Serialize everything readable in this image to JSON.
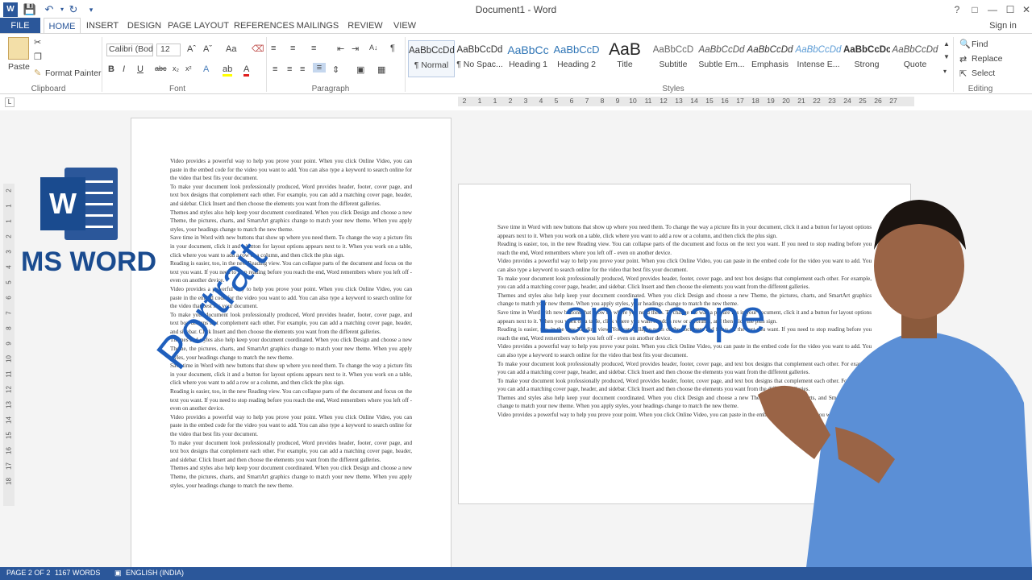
{
  "window": {
    "title": "Document1 - Word"
  },
  "account": {
    "signin": "Sign in"
  },
  "tabs": [
    "FILE",
    "HOME",
    "INSERT",
    "DESIGN",
    "PAGE LAYOUT",
    "REFERENCES",
    "MAILINGS",
    "REVIEW",
    "VIEW"
  ],
  "clipboard": {
    "paste": "Paste",
    "format_painter": "Format Painter",
    "label": "Clipboard"
  },
  "font": {
    "name": "Calibri (Body)",
    "size": "12",
    "label": "Font"
  },
  "paragraph": {
    "label": "Paragraph"
  },
  "styles": {
    "label": "Styles",
    "items": [
      {
        "preview": "AaBbCcDd",
        "name": "¶ Normal"
      },
      {
        "preview": "AaBbCcDd",
        "name": "¶ No Spac..."
      },
      {
        "preview": "AaBbCc",
        "name": "Heading 1"
      },
      {
        "preview": "AaBbCcD",
        "name": "Heading 2"
      },
      {
        "preview": "AaB",
        "name": "Title"
      },
      {
        "preview": "AaBbCcD",
        "name": "Subtitle"
      },
      {
        "preview": "AaBbCcDd",
        "name": "Subtle Em..."
      },
      {
        "preview": "AaBbCcDd",
        "name": "Emphasis"
      },
      {
        "preview": "AaBbCcDd",
        "name": "Intense E..."
      },
      {
        "preview": "AaBbCcDc",
        "name": "Strong"
      },
      {
        "preview": "AaBbCcDd",
        "name": "Quote"
      }
    ]
  },
  "editing": {
    "find": "Find",
    "replace": "Replace",
    "select": "Select",
    "label": "Editing"
  },
  "ruler": [
    "2",
    "1",
    "1",
    "2",
    "3",
    "4",
    "5",
    "6",
    "7",
    "8",
    "9",
    "10",
    "11",
    "12",
    "13",
    "14",
    "15",
    "16",
    "17",
    "18",
    "19",
    "20",
    "21",
    "22",
    "23",
    "24",
    "25",
    "26",
    "27"
  ],
  "vruler": [
    "2",
    "1",
    "1",
    "2",
    "3",
    "4",
    "5",
    "6",
    "7",
    "8",
    "9",
    "10",
    "11",
    "12",
    "13",
    "14",
    "15",
    "16",
    "17",
    "18"
  ],
  "overlay": {
    "app_name": "MS WORD",
    "portrait": "Portrait",
    "landscape": "Landscape",
    "logo_letter": "W"
  },
  "page1": {
    "paragraphs": [
      "Video provides a powerful way to help you prove your point. When you click Online Video, you can paste in the embed code for the video you want to add. You can also type a keyword to search online for the video that best fits your document.",
      "To make your document look professionally produced, Word provides header, footer, cover page, and text box designs that complement each other. For example, you can add a matching cover page, header, and sidebar. Click Insert and then choose the elements you want from the different galleries.",
      "Themes and styles also help keep your document coordinated. When you click Design and choose a new Theme, the pictures, charts, and SmartArt graphics change to match your new theme. When you apply styles, your headings change to match the new theme.",
      "Save time in Word with new buttons that show up where you need them. To change the way a picture fits in your document, click it and a button for layout options appears next to it. When you work on a table, click where you want to add a row or a column, and then click the plus sign.",
      "Reading is easier, too, in the new Reading view. You can collapse parts of the document and focus on the text you want. If you need to stop reading before you reach the end, Word remembers where you left off - even on another device.",
      "Video provides a powerful way to help you prove your point. When you click Online Video, you can paste in the embed code for the video you want to add. You can also type a keyword to search online for the video that best fits your document.",
      "To make your document look professionally produced, Word provides header, footer, cover page, and text box designs that complement each other. For example, you can add a matching cover page, header, and sidebar. Click Insert and then choose the elements you want from the different galleries.",
      "Themes and styles also help keep your document coordinated. When you click Design and choose a new Theme, the pictures, charts, and SmartArt graphics change to match your new theme. When you apply styles, your headings change to match the new theme.",
      "Save time in Word with new buttons that show up where you need them. To change the way a picture fits in your document, click it and a button for layout options appears next to it. When you work on a table, click where you want to add a row or a column, and then click the plus sign.",
      "Reading is easier, too, in the new Reading view. You can collapse parts of the document and focus on the text you want. If you need to stop reading before you reach the end, Word remembers where you left off - even on another device.",
      "Video provides a powerful way to help you prove your point. When you click Online Video, you can paste in the embed code for the video you want to add. You can also type a keyword to search online for the video that best fits your document.",
      "To make your document look professionally produced, Word provides header, footer, cover page, and text box designs that complement each other. For example, you can add a matching cover page, header, and sidebar. Click Insert and then choose the elements you want from the different galleries.",
      "Themes and styles also help keep your document coordinated. When you click Design and choose a new Theme, the pictures, charts, and SmartArt graphics change to match your new theme. When you apply styles, your headings change to match the new theme."
    ]
  },
  "page2": {
    "paragraphs": [
      "Save time in Word with new buttons that show up where you need them. To change the way a picture fits in your document, click it and a button for layout options appears next to it. When you work on a table, click where you want to add a row or a column, and then click the plus sign.",
      "Reading is easier, too, in the new Reading view. You can collapse parts of the document and focus on the text you want. If you need to stop reading before you reach the end, Word remembers where you left off - even on another device.",
      "Video provides a powerful way to help you prove your point. When you click Online Video, you can paste in the embed code for the video you want to add. You can also type a keyword to search online for the video that best fits your document.",
      "To make your document look professionally produced, Word provides header, footer, cover page, and text box designs that complement each other. For example, you can add a matching cover page, header, and sidebar. Click Insert and then choose the elements you want from the different galleries.",
      "Themes and styles also help keep your document coordinated. When you click Design and choose a new Theme, the pictures, charts, and SmartArt graphics change to match your new theme. When you apply styles, your headings change to match the new theme.",
      "Save time in Word with new buttons that show up where you need them. To change the way a picture fits in your document, click it and a button for layout options appears next to it. When you work on a table, click where you want to add a row or a column, and then click the plus sign.",
      "Reading is easier, too, in the new Reading view. You can collapse parts of the document and focus on the text you want. If you need to stop reading before you reach the end, Word remembers where you left off - even on another device.",
      "Video provides a powerful way to help you prove your point. When you click Online Video, you can paste in the embed code for the video you want to add. You can also type a keyword to search online for the video that best fits your document.",
      "To make your document look professionally produced, Word provides header, footer, cover page, and text box designs that complement each other. For example, you can add a matching cover page, header, and sidebar. Click Insert and then choose the elements you want from the different galleries.",
      "To make your document look professionally produced, Word provides header, footer, cover page, and text box designs that complement each other. For example, you can add a matching cover page, header, and sidebar. Click Insert and then choose the elements you want from the different galleries.",
      "Themes and styles also help keep your document coordinated. When you click Design and choose a new Theme, the pictures, charts, and SmartArt graphics change to match your new theme. When you apply styles, your headings change to match the new theme.",
      "Video provides a powerful way to help you prove your point. When you click Online Video, you can paste in the embed code for the video you want to add."
    ]
  },
  "status": {
    "page": "PAGE 2 OF 2",
    "words": "1167 WORDS",
    "language": "ENGLISH (INDIA)"
  },
  "colors": {
    "word_blue": "#2b579a",
    "overlay_blue": "#1f5fbd",
    "shirt_blue": "#5b8fd6"
  }
}
